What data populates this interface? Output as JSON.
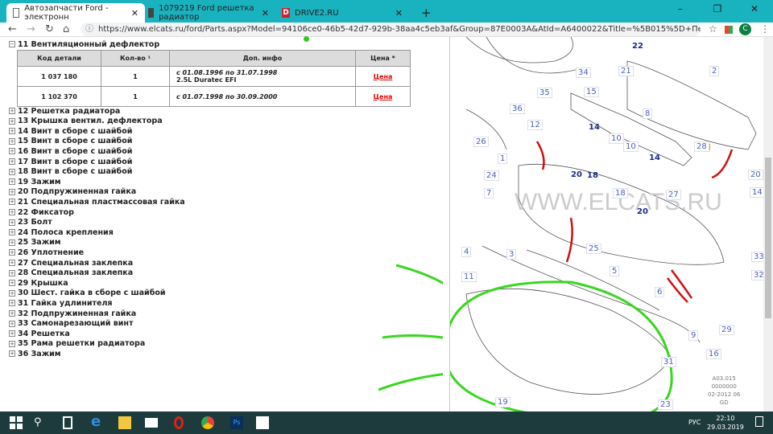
{
  "browser": {
    "tabs": [
      {
        "title": "Автозапчасти Ford - электронн",
        "active": true
      },
      {
        "title": "1079219 Ford решетка радиатор",
        "active": false
      },
      {
        "title": "DRIVE2.RU",
        "active": false
      }
    ],
    "new_tab": "+",
    "url": "https://www.elcats.ru/ford/Parts.aspx?Model=94106ce0-46b5-42d7-929b-38aa4c5eb3af&Group=87E0003A&AtId=A6400022&Title=%5B015%5D+Передние+бамп...",
    "avatar_letter": "C"
  },
  "expanded": {
    "label": "11  Вентиляционный дефлектор",
    "headers": [
      "Код детали",
      "Кол-во ¹",
      "Доп. инфо",
      "Цена *"
    ],
    "rows": [
      {
        "code": "1 037 180",
        "qty": "1",
        "info": "с 01.08.1996 по 31.07.1998",
        "info2": "2.5L Duratec EFI",
        "price": "Цена"
      },
      {
        "code": "1 102 370",
        "qty": "1",
        "info": "с 01.07.1998 по 30.09.2000",
        "info2": "",
        "price": "Цена"
      }
    ]
  },
  "parts": [
    "12  Решетка радиатора",
    "13  Крышка вентил. дефлектора",
    "14  Винт в сборе с шайбой",
    "15  Винт в сборе с шайбой",
    "16  Винт в сборе с шайбой",
    "17  Винт в сборе с шайбой",
    "18  Винт в сборе с шайбой",
    "19  Зажим",
    "20  Подпружиненная гайка",
    "21  Специальная пластмассовая гайка",
    "22  Фиксатор",
    "23  Болт",
    "24  Полоса крепления",
    "25  Зажим",
    "26  Уплотнение",
    "27  Специальная заклепка",
    "28  Специальная заклепка",
    "29  Крышка",
    "30  Шест. гайка в сборе с шайбой",
    "31  Гайка удлинителя",
    "32  Подпружиненная гайка",
    "33  Самонарезающий винт",
    "34  Решетка",
    "35  Рама решетки радиатора",
    "36  Зажим"
  ],
  "diagram": {
    "callouts": [
      "22",
      "2",
      "34",
      "21",
      "15",
      "36",
      "35",
      "12",
      "8",
      "14",
      "10",
      "10",
      "14",
      "26",
      "1",
      "28",
      "24",
      "20",
      "18",
      "18",
      "20",
      "7",
      "27",
      "14",
      "20",
      "4",
      "3",
      "25",
      "5",
      "33",
      "32",
      "6",
      "11",
      "9",
      "29",
      "16",
      "31",
      "19",
      "23"
    ],
    "watermark": "WWW.ELCATS.RU",
    "code": [
      "A03.015",
      "0000000",
      "02-2012 06",
      "GD"
    ]
  },
  "taskbar": {
    "lang": "РУС",
    "time": "22:10",
    "date": "29.03.2019"
  }
}
